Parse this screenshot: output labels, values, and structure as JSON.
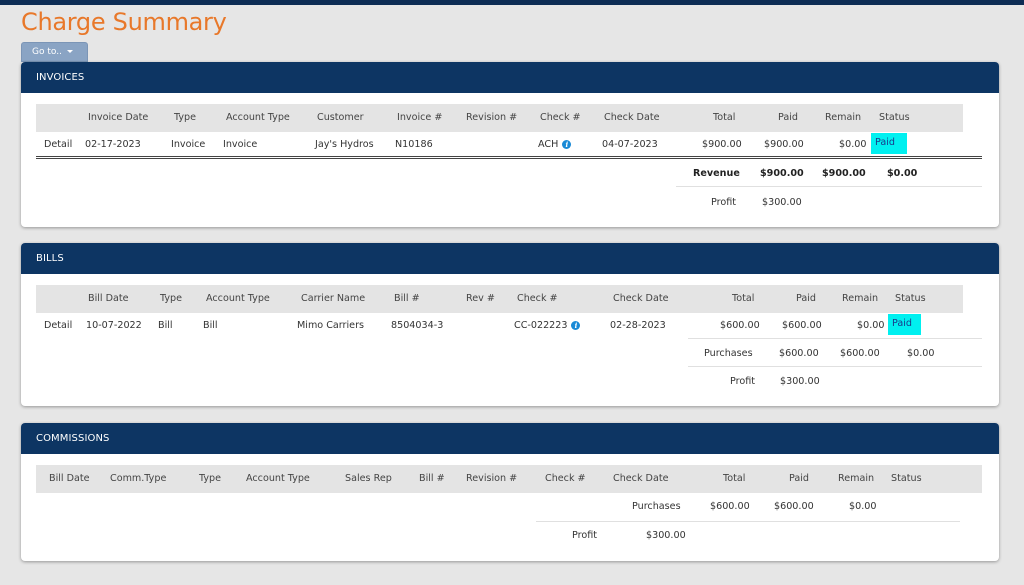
{
  "page": {
    "title": "Charge Summary",
    "goto_label": "Go to.."
  },
  "colors": {
    "header_bg": "#0d3563",
    "accent": "#e8782a",
    "paid_bg": "#00f0f0"
  },
  "invoices": {
    "title": "INVOICES",
    "columns": [
      "Invoice Date",
      "Type",
      "Account Type",
      "Customer",
      "Invoice #",
      "Revision #",
      "Check #",
      "Check Date",
      "Total",
      "Paid",
      "Remain",
      "Status"
    ],
    "row": {
      "link": "Detail",
      "invoice_date": "02-17-2023",
      "type": "Invoice",
      "account_type": "Invoice",
      "customer": "Jay's Hydros",
      "invoice_no": "N10186",
      "revision": "",
      "check_no": "ACH",
      "check_date": "04-07-2023",
      "total": "$900.00",
      "paid": "$900.00",
      "remain": "$0.00",
      "status": "Paid"
    },
    "summary": {
      "revenue_label": "Revenue",
      "revenue_total": "$900.00",
      "revenue_paid": "$900.00",
      "revenue_remain": "$0.00",
      "profit_label": "Profit",
      "profit_value": "$300.00"
    }
  },
  "bills": {
    "title": "BILLS",
    "columns": [
      "Bill Date",
      "Type",
      "Account Type",
      "Carrier Name",
      "Bill #",
      "Rev #",
      "Check #",
      "Check Date",
      "Total",
      "Paid",
      "Remain",
      "Status"
    ],
    "row": {
      "link": "Detail",
      "bill_date": "10-07-2022",
      "type": "Bill",
      "account_type": "Bill",
      "carrier": "Mimo Carriers",
      "bill_no": "8504034-3",
      "rev": "",
      "check_no": "CC-022223",
      "check_date": "02-28-2023",
      "total": "$600.00",
      "paid": "$600.00",
      "remain": "$0.00",
      "status": "Paid"
    },
    "summary": {
      "purchases_label": "Purchases",
      "purchases_total": "$600.00",
      "purchases_paid": "$600.00",
      "purchases_remain": "$0.00",
      "profit_label": "Profit",
      "profit_value": "$300.00"
    }
  },
  "commissions": {
    "title": "COMMISSIONS",
    "columns": [
      "Bill Date",
      "Comm.Type",
      "Type",
      "Account Type",
      "Sales Rep",
      "Bill #",
      "Revision #",
      "Check #",
      "Check Date",
      "Total",
      "Paid",
      "Remain",
      "Status"
    ],
    "summary": {
      "purchases_label": "Purchases",
      "purchases_total": "$600.00",
      "purchases_paid": "$600.00",
      "purchases_remain": "$0.00",
      "profit_label": "Profit",
      "profit_value": "$300.00"
    }
  }
}
